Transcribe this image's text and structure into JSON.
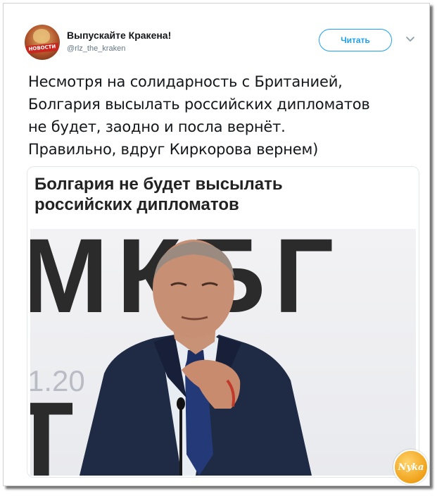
{
  "account": {
    "name": "Выпускайте Кракена!",
    "handle": "@rlz_the_kraken",
    "avatar_text": "НОВОСТИ"
  },
  "header": {
    "follow_label": "Читать",
    "menu_icon": "chevron-down-icon"
  },
  "tweet": {
    "lines": [
      "Несмотря на солидарность с Британией,",
      "Болгария высылать российских дипломатов",
      "не будет, заодно и посла вернёт.",
      "Правильно, вдруг Киркорова вернем)"
    ]
  },
  "card": {
    "headline_lines": [
      "Болгария не будет высылать",
      "российских дипломатов"
    ],
    "photo": {
      "letters": "МКБГ",
      "bottom_letters": "ТМ",
      "year_fragment": "1.20"
    }
  },
  "watermark": {
    "logo_text": "Nyka"
  },
  "colors": {
    "accent": "#1da1f2",
    "handle_gray": "#657786",
    "text": "#14171a",
    "suit": "#1f2a44"
  }
}
